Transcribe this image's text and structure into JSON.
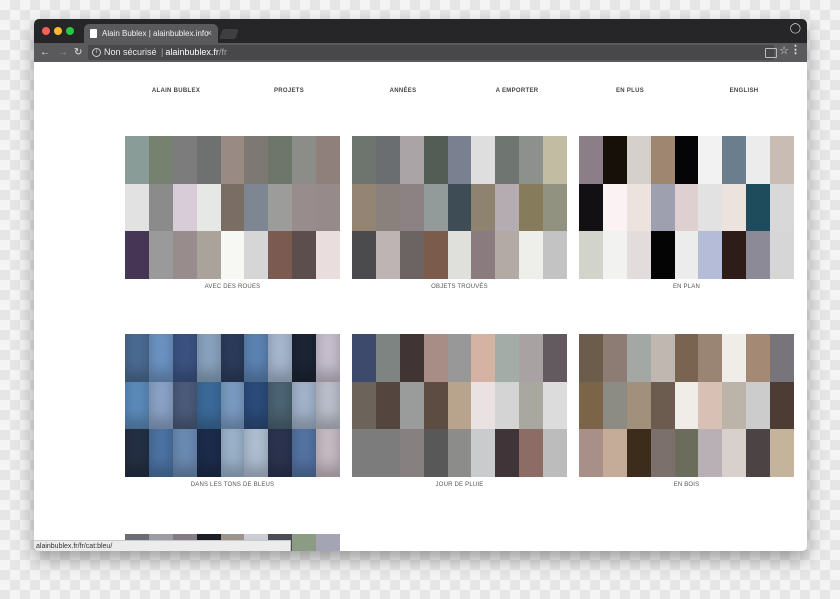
{
  "browser": {
    "tab_title": "Alain Bublex | alainbublex.info",
    "tab_close": "×",
    "url_security": "Non sécurisé",
    "url_sep": "|",
    "url_domain": "alainbublex.fr",
    "url_path": "/fr",
    "status_url": "alainbublex.fr/fr/cat:bleu/",
    "icons": [
      "back-icon",
      "forward-icon",
      "reload-icon",
      "info-icon",
      "star-icon",
      "cast-icon",
      "menu-icon",
      "user-icon",
      "page-icon",
      "close-icon"
    ]
  },
  "nav": [
    "ALAIN BUBLEX",
    "PROJETS",
    "ANNÉES",
    "A EMPORTER",
    "EN PLUS",
    "ENGLISH"
  ],
  "categories": [
    {
      "label": "AVEC DES ROUES",
      "photo": false,
      "colors": [
        "#8a9c98",
        "#76826f",
        "#7c7c7c",
        "#6f7070",
        "#9a8a84",
        "#7e7874",
        "#6e766c",
        "#8c8c88",
        "#8f807b",
        "#e2e2e2",
        "#8b8b8b",
        "#d8ccd8",
        "#e6e8e6",
        "#7a6e64",
        "#7e8692",
        "#9c9c9a",
        "#988c8c",
        "#968a8a",
        "#473555",
        "#9a9a9a",
        "#998c8c",
        "#aaa39c",
        "#f7f7f3",
        "#d6d6d6",
        "#7b5a52",
        "#5c4e4c",
        "#e9dedd"
      ]
    },
    {
      "label": "OBJETS TROUVÉS",
      "photo": false,
      "colors": [
        "#6e746e",
        "#6a6e70",
        "#aaa4a6",
        "#545d55",
        "#7b8090",
        "#dedede",
        "#6f7672",
        "#8d918e",
        "#c2bca2",
        "#948474",
        "#8a807c",
        "#8c8284",
        "#929a9a",
        "#3e4c56",
        "#8e8270",
        "#b4acb0",
        "#867c5c",
        "#919280",
        "#4b4b4d",
        "#beb4b4",
        "#6c6462",
        "#7b5c4c",
        "#dfdfdb",
        "#8a7c7e",
        "#b3aaa5",
        "#eeeeea",
        "#c3c3c3"
      ]
    },
    {
      "label": "EN PLAN",
      "photo": false,
      "colors": [
        "#8c7e86",
        "#171008",
        "#d6d0cc",
        "#9e8670",
        "#050507",
        "#f2f2f2",
        "#6a7e8e",
        "#ececec",
        "#c8bcb4",
        "#121012",
        "#fbf2f4",
        "#ece2de",
        "#9ea0b0",
        "#ded0d0",
        "#e2e2e2",
        "#ece2de",
        "#1f4c5c",
        "#d8d8d8",
        "#d2d4cc",
        "#f2f2f0",
        "#e2dcdc",
        "#040404",
        "#ececec",
        "#b4bcd8",
        "#2e1c18",
        "#8c8a96",
        "#d6d6d6"
      ]
    },
    {
      "label": "DANS LES TONS DE BLEUS",
      "photo": true,
      "colors": [
        "#4c6c94",
        "#6c94c4",
        "#3c5484",
        "#8aa4c0",
        "#2c3c5c",
        "#5c84b4",
        "#a8b8d0",
        "#1c2434",
        "#c8c0d0",
        "#5c8cbc",
        "#8ca4c8",
        "#4c5c7c",
        "#3c6c9c",
        "#7c9cc4",
        "#2c4c7c",
        "#4c6474",
        "#a4b4cc",
        "#bcc0cc",
        "#243044",
        "#4c74a4",
        "#6c8cb4",
        "#1c2c4c",
        "#9cb4cc",
        "#b0c0d4",
        "#2c3450",
        "#5474a4",
        "#c8bcc4"
      ]
    },
    {
      "label": "JOUR DE PLUIE",
      "photo": false,
      "colors": [
        "#3e4a6c",
        "#7e8482",
        "#403434",
        "#a88c86",
        "#989898",
        "#d4b2a4",
        "#a4aca8",
        "#a8a2a2",
        "#625a5e",
        "#6c645a",
        "#54463e",
        "#9a9c9c",
        "#5c4c42",
        "#b8a48c",
        "#eae2e2",
        "#d4d4d4",
        "#a8a8a0",
        "#dcdcdc",
        "#7c7c7c",
        "#7c7c7c",
        "#868080",
        "#585858",
        "#8c8c8a",
        "#c8cccc",
        "#403438",
        "#8c6c64",
        "#bcbcbc"
      ]
    },
    {
      "label": "EN BOIS",
      "photo": false,
      "colors": [
        "#6c5c4c",
        "#8c7c74",
        "#a4a8a4",
        "#c0b8b0",
        "#786450",
        "#9a8474",
        "#f0ece8",
        "#a48a74",
        "#78747c",
        "#7c6448",
        "#8c8c84",
        "#a0907c",
        "#6c5c50",
        "#f0ece8",
        "#d8c0b4",
        "#bcb4a8",
        "#cccccc",
        "#4c3c34",
        "#a89088",
        "#c4ac98",
        "#3c2c1c",
        "#7c706c",
        "#6c6c5c",
        "#b8b0b4",
        "#d8d0cc",
        "#4c4444",
        "#c4b49c"
      ]
    }
  ],
  "partial_row": [
    "#6c6c74",
    "#9c9ca4",
    "#847c84",
    "#1c1c24",
    "#9c948c",
    "#ccccd4",
    "#4c4c54",
    "#8c9c84",
    "#a4a4b4"
  ]
}
